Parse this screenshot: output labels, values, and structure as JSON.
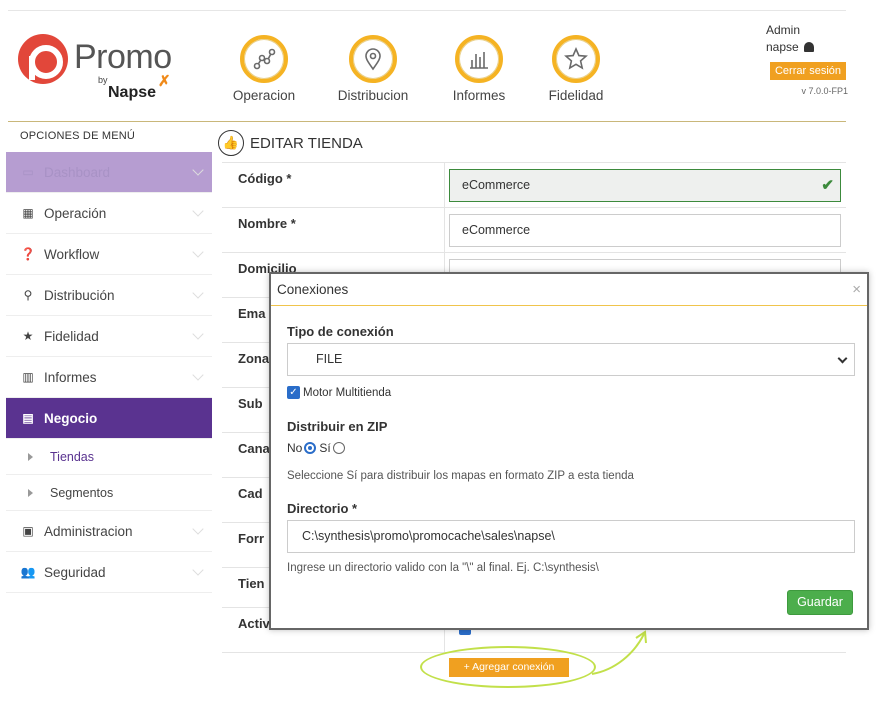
{
  "header": {
    "logo": {
      "name": "Promo",
      "by": "by",
      "brand": "Napse"
    },
    "nav": [
      {
        "label": "Operacion",
        "icon": "operation-icon"
      },
      {
        "label": "Distribucion",
        "icon": "map-pin-icon"
      },
      {
        "label": "Informes",
        "icon": "bar-chart-icon"
      },
      {
        "label": "Fidelidad",
        "icon": "star-icon"
      }
    ],
    "user": {
      "role": "Admin",
      "name": "napse",
      "logout_label": "Cerrar sesión",
      "version": "v 7.0.0-FP1"
    }
  },
  "sidebar": {
    "title": "OPCIONES DE MENÚ",
    "items": [
      {
        "label": "Dashboard",
        "icon": "dashboard-icon"
      },
      {
        "label": "Operación",
        "icon": "grid-icon"
      },
      {
        "label": "Workflow",
        "icon": "question-icon"
      },
      {
        "label": "Distribución",
        "icon": "map-marker-icon"
      },
      {
        "label": "Fidelidad",
        "icon": "star-icon"
      },
      {
        "label": "Informes",
        "icon": "bar-chart-icon"
      },
      {
        "label": "Negocio",
        "icon": "building-icon"
      },
      {
        "label": "Administracion",
        "icon": "calendar-check-icon"
      },
      {
        "label": "Seguridad",
        "icon": "users-icon"
      }
    ],
    "sub_items": [
      {
        "label": "Tiendas"
      },
      {
        "label": "Segmentos"
      }
    ]
  },
  "form": {
    "title": "EDITAR TIENDA",
    "rows": [
      {
        "label": "Código *",
        "value": "eCommerce"
      },
      {
        "label": "Nombre *",
        "value": "eCommerce"
      },
      {
        "label": "Domicilio",
        "value": ""
      },
      {
        "label": "Ema",
        "value": ""
      },
      {
        "label": "Zona",
        "value": ""
      },
      {
        "label": "Sub",
        "value": ""
      },
      {
        "label": "Cana",
        "value": ""
      },
      {
        "label": "Cad",
        "value": ""
      },
      {
        "label": "Forr",
        "value": ""
      },
      {
        "label": "Tien",
        "value": ""
      },
      {
        "label": "Activ",
        "value": ""
      }
    ],
    "add_connection_label": "+ Agregar conexión"
  },
  "modal": {
    "title": "Conexiones",
    "close": "×",
    "connection_type_label": "Tipo de conexión",
    "connection_type_value": "FILE",
    "multistore_label": "Motor Multitienda",
    "zip_label": "Distribuir en ZIP",
    "zip_no": "No",
    "zip_yes": "Sí",
    "zip_help": "Seleccione Sí para distribuir los mapas en formato ZIP a esta tienda",
    "directory_label": "Directorio *",
    "directory_value": "C:\\synthesis\\promo\\promocache\\sales\\napse\\",
    "directory_help": "Ingrese un directorio valido con la \"\\\" al final. Ej. C:\\synthesis\\",
    "save_label": "Guardar"
  },
  "colors": {
    "accent": "#f0a020",
    "primary_purple": "#5a3390",
    "dashboard_purple": "#b69dd1",
    "success": "#4cae4c",
    "annotation": "#c2e04a"
  }
}
